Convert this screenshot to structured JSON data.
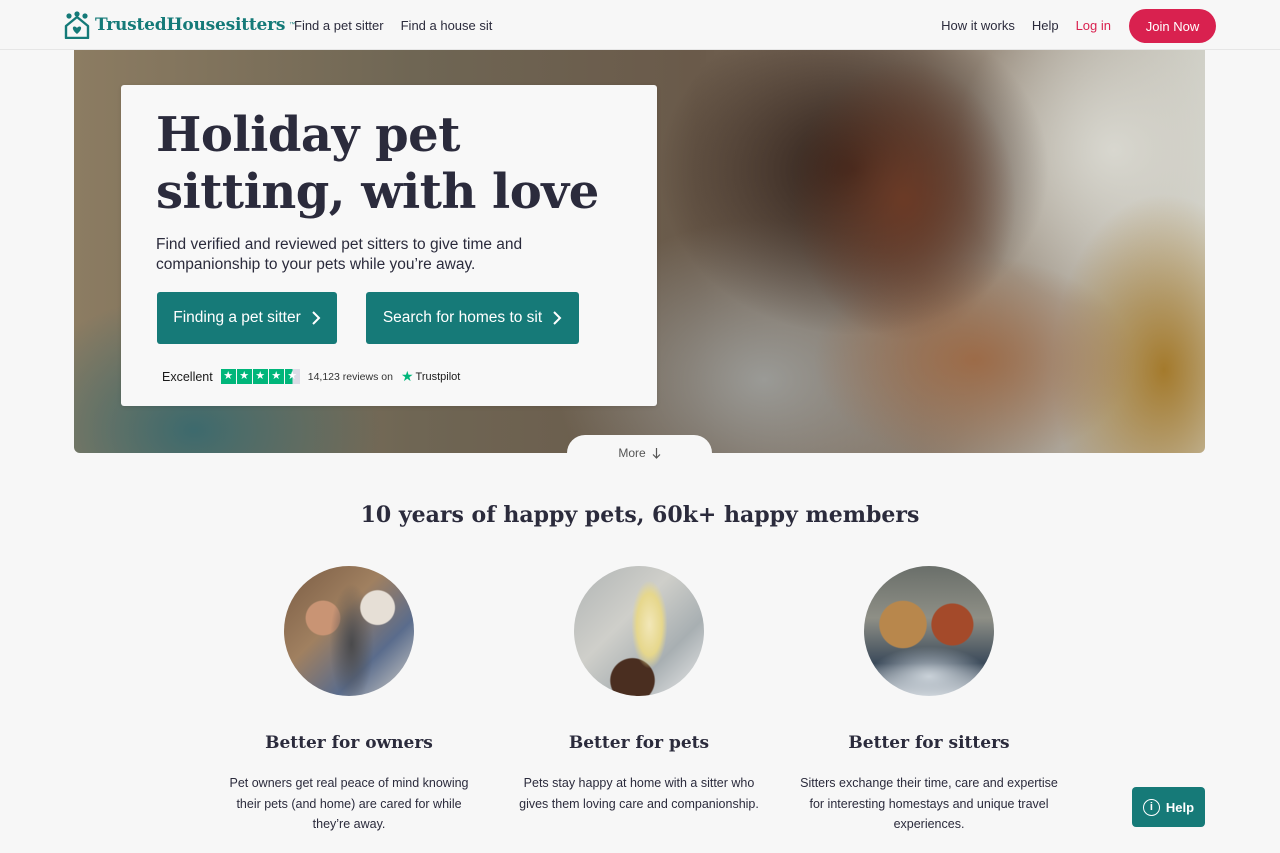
{
  "header": {
    "logo_text": "TrustedHousesitters",
    "logo_tm": "™",
    "nav_left": [
      "Find a pet sitter",
      "Find a house sit"
    ],
    "how_it_works": "How it works",
    "help": "Help",
    "login": "Log in",
    "join": "Join Now"
  },
  "hero": {
    "title": "Holiday pet sitting, with love",
    "subtitle": "Find verified and reviewed pet sitters to give time and companionship to your pets while you’re away.",
    "cta_primary": "Finding a pet sitter",
    "cta_secondary": "Search for homes to sit",
    "trust": {
      "rating_label": "Excellent",
      "rating_stars": 4.5,
      "review_count": "14,123 reviews on",
      "brand": "Trustpilot"
    },
    "more": "More"
  },
  "section": {
    "title": "10 years of happy pets, 60k+ happy members",
    "columns": [
      {
        "title": "Better for owners",
        "text": "Pet owners get real peace of mind knowing their pets (and home) are cared for while they’re away."
      },
      {
        "title": "Better for pets",
        "text": "Pets stay happy at home with a sitter who gives them loving care and companionship."
      },
      {
        "title": "Better for sitters",
        "text": "Sitters exchange their time, care and expertise for interesting homestays and unique travel experiences."
      }
    ]
  },
  "help_button": "Help",
  "colors": {
    "brand_teal": "#167a78",
    "accent_pink": "#d9214f",
    "trustpilot_green": "#00b67a"
  }
}
